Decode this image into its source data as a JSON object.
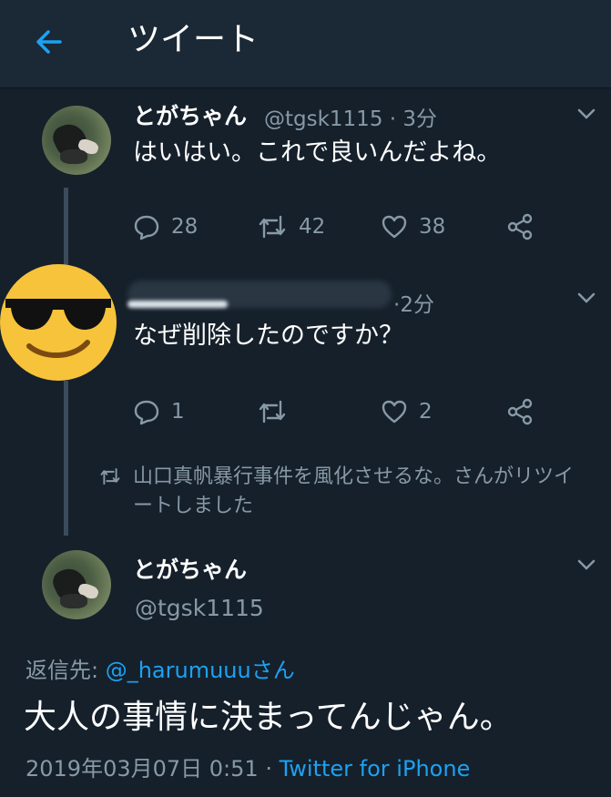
{
  "header": {
    "title": "ツイート",
    "back_icon": "arrow-left-icon",
    "accent": "#1da1f2"
  },
  "tweet1": {
    "name": "とがちゃん",
    "handle": "@tgsk1115",
    "sep": "·",
    "time": "3分",
    "text": "はいはい。これで良いんだよね。",
    "replies": "28",
    "retweets": "42",
    "likes": "38"
  },
  "tweet2": {
    "sep": "·",
    "time": "2分",
    "text": "なぜ削除したのですか？",
    "replies": "1",
    "likes": "2"
  },
  "retweet_notice": {
    "text": "山口真帆暴行事件を風化させるな。さんがリツイートしました"
  },
  "main_tweet": {
    "name": "とがちゃん",
    "handle": "@tgsk1115",
    "reply_prefix": "返信先: ",
    "reply_link": "@_harumuuuさん",
    "text": "大人の事情に決まってんじゃん。",
    "date": "2019年03月07日 0:51",
    "sep": "·",
    "source": "Twitter for iPhone"
  },
  "colors": {
    "background": "#15202b",
    "header": "#1b2836",
    "secondary_text": "#8899a6",
    "link": "#1da1f2"
  }
}
